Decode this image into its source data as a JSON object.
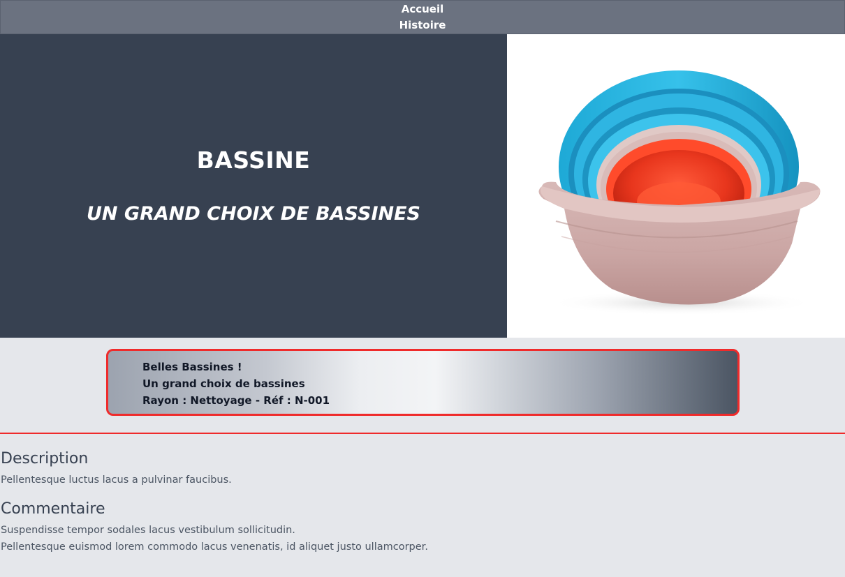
{
  "nav": {
    "items": [
      {
        "label": "Accueil"
      },
      {
        "label": "Histoire"
      }
    ]
  },
  "hero": {
    "title": "BASSINE",
    "subtitle": "UN GRAND CHOIX DE BASSINES",
    "image_icon": "basin-stack-photo"
  },
  "banner": {
    "line1": "Belles Bassines !",
    "line2": "Un grand choix de bassines",
    "line3": "Rayon : Nettoyage - Réf : N-001"
  },
  "description": {
    "heading": "Description",
    "text": "Pellentesque luctus lacus a pulvinar faucibus."
  },
  "comment": {
    "heading": "Commentaire",
    "line1": "Suspendisse tempor sodales lacus vestibulum sollicitudin.",
    "line2": "Pellentesque euismod lorem commodo lacus venenatis, id aliquet justo ullamcorper."
  },
  "colors": {
    "nav_bg": "#6b7280",
    "hero_bg": "#374151",
    "page_bg": "#e5e7eb",
    "accent_red": "#ef2b2b"
  }
}
